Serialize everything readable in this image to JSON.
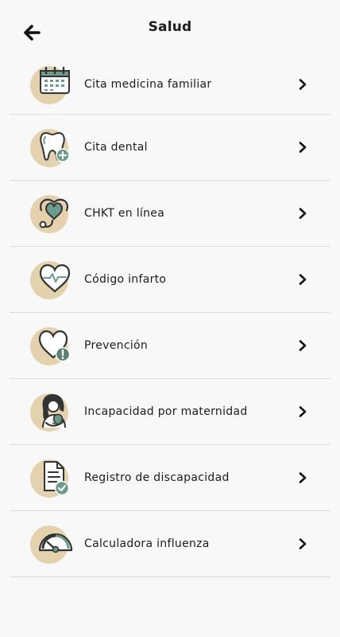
{
  "header": {
    "title": "Salud",
    "back_icon": "arrow-left-icon"
  },
  "items": [
    {
      "label": "Cita medicina familiar",
      "icon": "calendar-icon"
    },
    {
      "label": "Cita dental",
      "icon": "tooth-plus-icon"
    },
    {
      "label": "CHKT en línea",
      "icon": "stethoscope-heart-icon"
    },
    {
      "label": "Código infarto",
      "icon": "heart-pulse-icon"
    },
    {
      "label": "Prevención",
      "icon": "heart-alert-icon"
    },
    {
      "label": "Incapacidad por maternidad",
      "icon": "mother-baby-icon"
    },
    {
      "label": "Registro de discapacidad",
      "icon": "document-check-icon"
    },
    {
      "label": "Calculadora influenza",
      "icon": "gauge-icon"
    }
  ],
  "colors": {
    "accent_beige": "#e4d1ad",
    "icon_green": "#6c9a8b",
    "icon_stroke": "#3a3a3a",
    "divider": "#dcdcdc"
  }
}
